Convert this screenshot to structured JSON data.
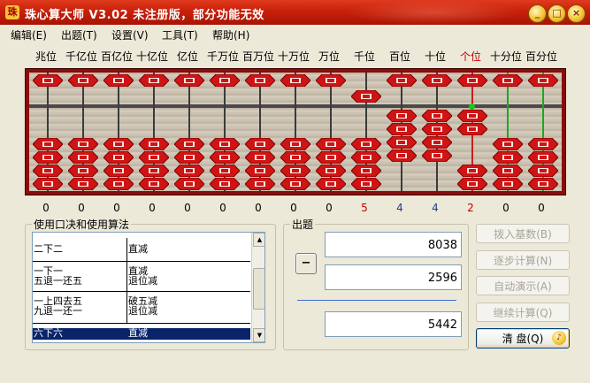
{
  "window": {
    "title": "珠心算大师 V3.02 未注册版，部分功能无效",
    "controls": {
      "minimize": "_",
      "maximize": "□",
      "close": "×"
    }
  },
  "menu": [
    "编辑(E)",
    "出题(T)",
    "设置(V)",
    "工具(T)",
    "帮助(H)"
  ],
  "abacus": {
    "positions": [
      "兆位",
      "千亿位",
      "百亿位",
      "十亿位",
      "亿位",
      "千万位",
      "百万位",
      "十万位",
      "万位",
      "千位",
      "百位",
      "十位",
      "个位",
      "十分位",
      "百分位"
    ],
    "digits": [
      "0",
      "0",
      "0",
      "0",
      "0",
      "0",
      "0",
      "0",
      "0",
      "5",
      "4",
      "4",
      "2",
      "0",
      "0"
    ],
    "current_position": "个位",
    "bead_label": "珠"
  },
  "left_panel": {
    "title": "使用口决和使用算法",
    "rows": [
      {
        "rule": "二下二",
        "method": "直减"
      },
      {
        "rule": "一下一\n五退一还五",
        "method": "直减\n退位减"
      },
      {
        "rule": "一上四去五\n九退一还一",
        "method": "破五减\n退位减"
      },
      {
        "rule": "六下六",
        "method": "直减",
        "selected": true
      }
    ]
  },
  "problem": {
    "title": "出题",
    "operator": "−",
    "operand1": "8038",
    "operand2": "2596",
    "result": "5442"
  },
  "buttons": {
    "set_base": "拨入基数(B)",
    "step": "逐步计算(N)",
    "auto_demo": "自动演示(A)",
    "continue": "继续计算(Q)",
    "clear": "清  盘(Q)"
  }
}
